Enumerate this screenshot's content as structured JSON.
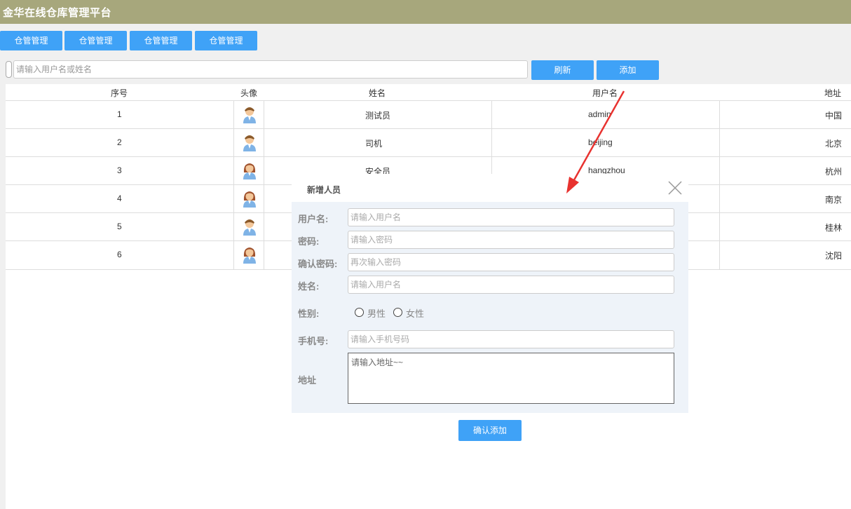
{
  "app": {
    "title": "金华在线仓库管理平台"
  },
  "nav": {
    "buttons": [
      "仓管管理",
      "仓管管理",
      "仓管管理",
      "仓管管理"
    ]
  },
  "search": {
    "placeholder": "请输入用户名或姓名",
    "refresh_label": "刷新",
    "add_label": "添加"
  },
  "table": {
    "headers": {
      "index": "序号",
      "avatar": "头像",
      "name": "姓名",
      "username": "用户名",
      "address": "地址"
    },
    "rows": [
      {
        "index": "1",
        "name": "测试员",
        "username": "admin",
        "address": "中国",
        "avatar": "male"
      },
      {
        "index": "2",
        "name": "司机",
        "username": "beijing",
        "address": "北京",
        "avatar": "male"
      },
      {
        "index": "3",
        "name": "安全员",
        "username": "hangzhou",
        "address": "杭州",
        "avatar": "female"
      },
      {
        "index": "4",
        "name": "",
        "username": "",
        "address": "南京",
        "avatar": "female"
      },
      {
        "index": "5",
        "name": "",
        "username": "",
        "address": "桂林",
        "avatar": "male"
      },
      {
        "index": "6",
        "name": "",
        "username": "",
        "address": "沈阳",
        "avatar": "female"
      }
    ]
  },
  "modal": {
    "title": "新增人员",
    "fields": {
      "username": {
        "label": "用户名:",
        "placeholder": "请输入用户名"
      },
      "password": {
        "label": "密码:",
        "placeholder": "请输入密码"
      },
      "confirm_password": {
        "label": "确认密码:",
        "placeholder": "再次输入密码"
      },
      "name": {
        "label": "姓名:",
        "placeholder": "请输入用户名"
      },
      "gender": {
        "label": "性别:",
        "options": [
          "男性",
          "女性"
        ]
      },
      "phone": {
        "label": "手机号:",
        "placeholder": "请输入手机号码"
      },
      "address": {
        "label": "地址",
        "placeholder": "请输入地址~~"
      }
    },
    "confirm_label": "确认添加"
  },
  "colors": {
    "header": "#a7a77c",
    "accent": "#3fa2f7",
    "annotation_arrow": "#e8322f"
  }
}
